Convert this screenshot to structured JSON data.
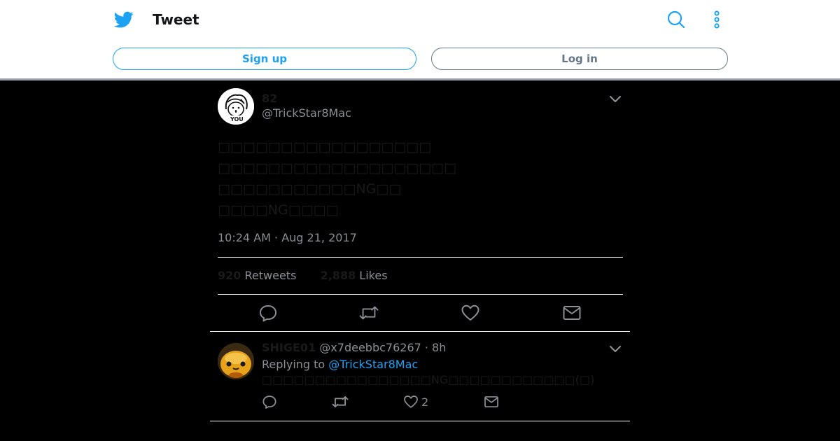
{
  "header": {
    "title": "Tweet",
    "signup_label": "Sign up",
    "login_label": "Log in",
    "icons": {
      "logo": "twitter-bird-icon",
      "search": "search-icon",
      "more": "more-vertical-icon"
    },
    "colors": {
      "brand": "#1da1f2",
      "muted": "#657786"
    }
  },
  "tweet": {
    "display_name": "82",
    "handle": "@TrickStar8Mac",
    "text_lines": [
      "□□□□□□□□□□□□□□□□□",
      "□□□□□□□□□□□□□□□□□□□",
      "□□□□□□□□□□□NG□□",
      "□□□□NG□□□□"
    ],
    "timestamp": "10:24 AM · Aug 21, 2017",
    "retweets_count": "920",
    "retweets_label": "Retweets",
    "likes_count": "2,888",
    "likes_label": "Likes",
    "avatar_text": "YOU"
  },
  "reply": {
    "display_name": "SHIGE01",
    "handle_time": "@x7deebbc76267 · 8h",
    "replying_prefix": "Replying to",
    "replying_handle": "@TrickStar8Mac",
    "text": "□□□□□□□□□□□□□□□□NG□□□□□□□□□□□□(□)",
    "like_count": "2"
  }
}
